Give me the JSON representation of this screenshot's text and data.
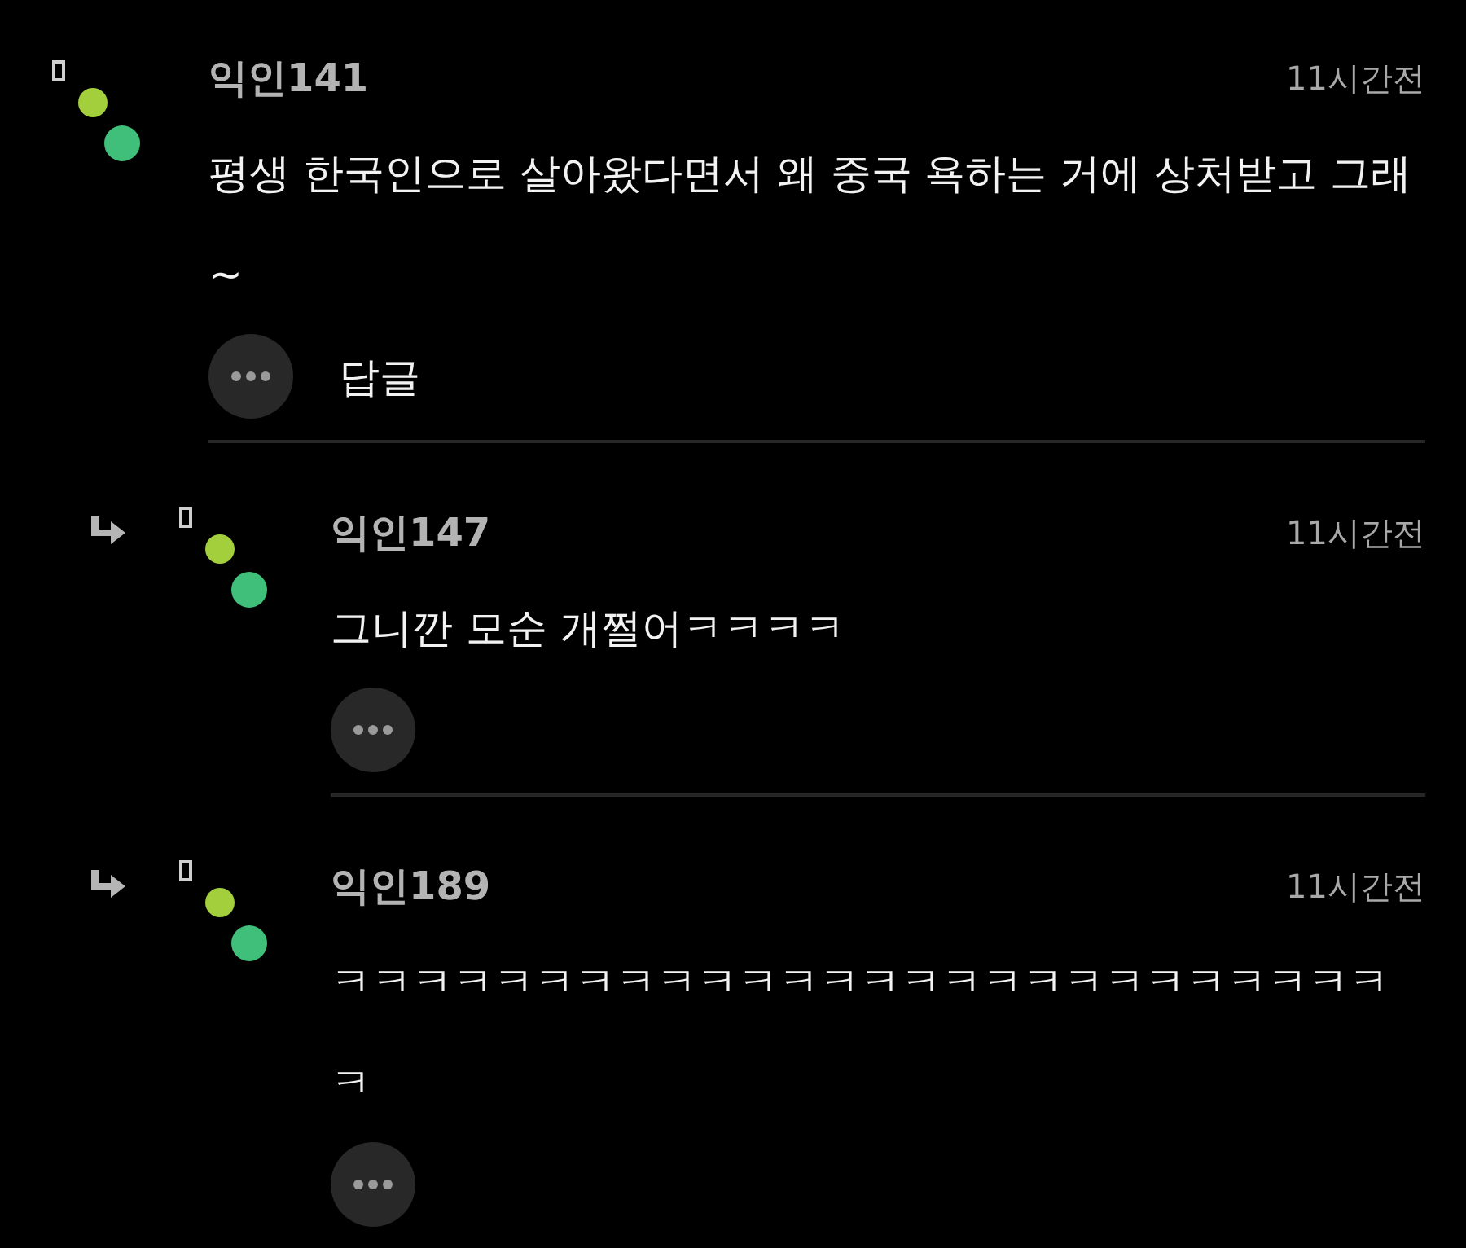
{
  "comments": [
    {
      "author": "익인141",
      "time": "11시간전",
      "text": "평생 한국인으로 살아왔다면서 왜 중국 욕하는 거에 상처받고 그래~",
      "reply_label": "답글",
      "replies": [
        {
          "author": "익인147",
          "time": "11시간전",
          "text": "그니깐 모순 개쩔어ㅋㅋㅋㅋ"
        },
        {
          "author": "익인189",
          "time": "11시간전",
          "text": "ㅋㅋㅋㅋㅋㅋㅋㅋㅋㅋㅋㅋㅋㅋㅋㅋㅋㅋㅋㅋㅋㅋㅋㅋㅋㅋㅋ"
        }
      ]
    }
  ]
}
